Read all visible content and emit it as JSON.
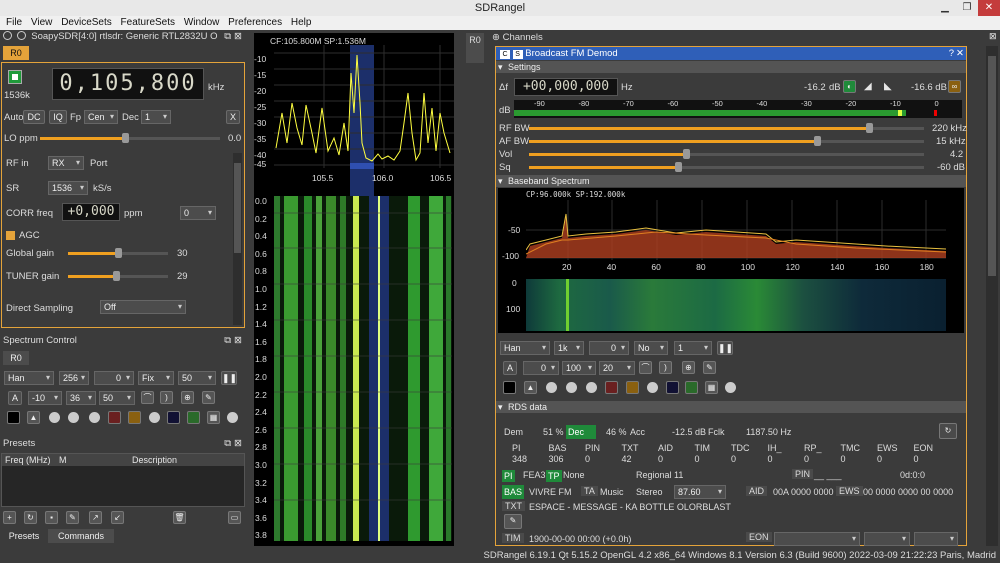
{
  "window": {
    "title": "SDRangel"
  },
  "menu": [
    "File",
    "View",
    "DeviceSets",
    "FeatureSets",
    "Window",
    "Preferences",
    "Help"
  ],
  "device": {
    "header": "SoapySDR[4:0] rtlsdr: Generic RTL2832U O",
    "tab": "R0",
    "sample_rate_label": "1536k",
    "center_freq": "0,105,800",
    "freq_unit": "kHz",
    "auto_label": "Auto",
    "dc_label": "DC",
    "iq_label": "IQ",
    "fp_label": "Fp",
    "fp_value": "Cen",
    "dec_label": "Dec",
    "dec_value": "1",
    "close_label": "X",
    "lo_ppm_label": "LO ppm",
    "lo_ppm_value": "0.0",
    "rf_in_label": "RF in",
    "rf_in_value": "RX",
    "port_label": "Port",
    "sr_label": "SR",
    "sr_value": "1536",
    "sr_unit": "kS/s",
    "corr_label": "CORR freq",
    "corr_value": "+0,000",
    "corr_unit": "ppm",
    "corr_sel": "0",
    "agc_label": "AGC",
    "global_gain_label": "Global gain",
    "global_gain_value": "30",
    "tuner_gain_label": "TUNER gain",
    "tuner_gain_value": "29",
    "direct_sampling_label": "Direct Sampling",
    "direct_sampling_value": "Off"
  },
  "spectrum_control": {
    "header": "Spectrum Control",
    "tab": "R0",
    "window": "Han",
    "fft": "256",
    "v1": "0",
    "fix": "Fix",
    "rate": "50",
    "ref": "-10",
    "range": "36",
    "avg": "50"
  },
  "presets": {
    "header": "Presets",
    "columns": [
      "Freq (MHz)",
      "M",
      "Description"
    ],
    "tabs": [
      "Presets",
      "Commands"
    ]
  },
  "main_spectrum": {
    "cf_label": "CF:105.800M SP:1.536M",
    "y_ticks": [
      "-10",
      "-15",
      "-20",
      "-25",
      "-30",
      "-35",
      "-40",
      "-45"
    ],
    "x_ticks": [
      "105.5",
      "106.0",
      "106.5"
    ],
    "wf_ticks": [
      "0.0",
      "0.2",
      "0.4",
      "0.6",
      "0.8",
      "1.0",
      "1.2",
      "1.4",
      "1.6",
      "1.8",
      "2.0",
      "2.2",
      "2.4",
      "2.6",
      "2.8",
      "3.0",
      "3.2",
      "3.4",
      "3.6",
      "3.8"
    ],
    "tab": "R0"
  },
  "channels": {
    "header": "Channels",
    "demod_title": "Broadcast FM Demod",
    "settings_header": "Settings",
    "delta_label": "Δf",
    "offset": "+00,000,000",
    "offset_unit": "Hz",
    "level1": "-16.2",
    "level1_unit": "dB",
    "level2": "-16.6 dB",
    "db_label": "dB",
    "db_ticks": [
      "-90",
      "-80",
      "-70",
      "-60",
      "-50",
      "-40",
      "-30",
      "-20",
      "-10",
      "0"
    ],
    "rf_bw_label": "RF BW",
    "rf_bw_value": "220 kHz",
    "af_bw_label": "AF BW",
    "af_bw_value": "15 kHz",
    "vol_label": "Vol",
    "vol_value": "4.2",
    "sq_label": "Sq",
    "sq_value": "-60 dB",
    "baseband_header": "Baseband Spectrum",
    "bb_label": "CP:96.000k SP:192.000k",
    "bb_y_ticks": [
      "-50",
      "-100"
    ],
    "bb_x_ticks": [
      "20",
      "40",
      "60",
      "80",
      "100",
      "120",
      "140",
      "160",
      "180"
    ],
    "bb_wf_ticks": [
      "0",
      "100"
    ],
    "bb_window": "Han",
    "bb_fft": "1k",
    "bb_v1": "0",
    "bb_no": "No",
    "bb_rate": "1",
    "bb_a": "A",
    "bb_ref": "0",
    "bb_range": "100",
    "bb_avg": "20"
  },
  "rds": {
    "header": "RDS data",
    "dem_label": "Dem",
    "dem_pct": "51 %",
    "dec_label": "Dec",
    "acc_pct": "46 %",
    "acc_label": "Acc",
    "fclk_db": "-12.5 dB",
    "fclk_label": "Fclk",
    "fclk_hz": "1187.50 Hz",
    "stats_headers": [
      "PI",
      "BAS",
      "PIN",
      "TXT",
      "AID",
      "TIM",
      "TDC",
      "IH_",
      "RP_",
      "TMC",
      "EWS",
      "EON"
    ],
    "stats_values": [
      "348",
      "306",
      "0",
      "42",
      "0",
      "0",
      "0",
      "0",
      "0",
      "0",
      "0",
      "0"
    ],
    "pi_label": "PI",
    "pi_value": "FEA3",
    "tp_label": "TP",
    "tp_value": "None",
    "region": "Regional 11",
    "pin_label": "PIN",
    "pin_value": "__ ___",
    "od_value": "0d:0:0",
    "bas_label": "BAS",
    "bas_value": "VIVRE FM",
    "ta_label": "TA",
    "ta_value": "Music",
    "stereo_label": "Stereo",
    "freq_sel": "87.60",
    "aid_label": "AID",
    "aid_value": "00A 0000 0000",
    "ews_label": "EWS",
    "ews_value": "00 0000 0000 00 0000",
    "txt_label": "TXT",
    "txt_value": "ESPACE - MESSAGE - KA BOTTLE   OLORBLAST",
    "tim_label": "TIM",
    "tim_value": "1900-00-00 00:00 (+0.0h)",
    "eon_label": "EON"
  },
  "statusbar": {
    "text": "SDRangel 6.19.1 Qt 5.15.2 OpenGL 4.2 x86_64 Windows 8.1 Version 6.3 (Build 9600)  2022-03-09 21:22:23 Paris, Madrid"
  },
  "colors": {
    "accent": "#e4a33a",
    "trace": "#ffff40",
    "green": "#1f8a3a",
    "waterfall": "#2a6a2a"
  }
}
